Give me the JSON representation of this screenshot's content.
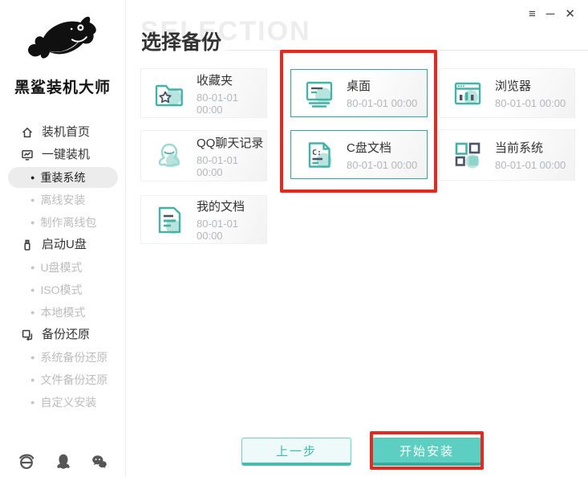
{
  "window": {
    "controls": {
      "menu": "≡",
      "minimize": "─",
      "close": "✕"
    }
  },
  "sidebar": {
    "logo_title": "黑鲨装机大师",
    "items": [
      {
        "label": "装机首页",
        "type": "top",
        "icon": "home-icon"
      },
      {
        "label": "一键装机",
        "type": "top",
        "icon": "monitor-chart-icon"
      },
      {
        "label": "重装系统",
        "type": "sub",
        "active": true
      },
      {
        "label": "离线安装",
        "type": "sub",
        "active": false
      },
      {
        "label": "制作离线包",
        "type": "sub",
        "active": false
      },
      {
        "label": "启动U盘",
        "type": "top",
        "icon": "usb-drive-icon"
      },
      {
        "label": "U盘模式",
        "type": "sub",
        "active": false
      },
      {
        "label": "ISO模式",
        "type": "sub",
        "active": false
      },
      {
        "label": "本地模式",
        "type": "sub",
        "active": false
      },
      {
        "label": "备份还原",
        "type": "top",
        "icon": "backup-restore-icon"
      },
      {
        "label": "系统备份还原",
        "type": "sub",
        "active": false
      },
      {
        "label": "文件备份还原",
        "type": "sub",
        "active": false
      },
      {
        "label": "自定义安装",
        "type": "sub",
        "active": false
      }
    ],
    "footer_icons": [
      "ie-icon",
      "qq-icon",
      "wechat-icon"
    ]
  },
  "main": {
    "watermark": "SELECTION",
    "title": "选择备份",
    "cards": [
      {
        "name": "收藏夹",
        "date": "80-01-01 00:00",
        "icon": "folder-star-icon",
        "selected": false
      },
      {
        "name": "桌面",
        "date": "80-01-01 00:00",
        "icon": "desktop-icon",
        "selected": true
      },
      {
        "name": "浏览器",
        "date": "80-01-01 00:00",
        "icon": "browser-icon",
        "selected": false
      },
      {
        "name": "QQ聊天记录",
        "date": "80-01-01 00:00",
        "icon": "qq-penguin-icon",
        "selected": false
      },
      {
        "name": "C盘文档",
        "date": "80-01-01 00:00",
        "icon": "c-drive-document-icon",
        "selected": true
      },
      {
        "name": "当前系统",
        "date": "80-01-01 00:00",
        "icon": "current-system-icon",
        "selected": false
      },
      {
        "name": "我的文档",
        "date": "80-01-01 00:00",
        "icon": "my-documents-icon",
        "selected": false
      }
    ],
    "buttons": {
      "prev": "上一步",
      "start": "开始安装"
    }
  },
  "colors": {
    "accent_teal": "#43b2a7",
    "accent_teal_light": "#b9e4de",
    "navy": "#4a5468",
    "annotation_red": "#e6281e",
    "start_button_fill": "#5ccfc2",
    "selected_card_border": "#2ea89d"
  }
}
